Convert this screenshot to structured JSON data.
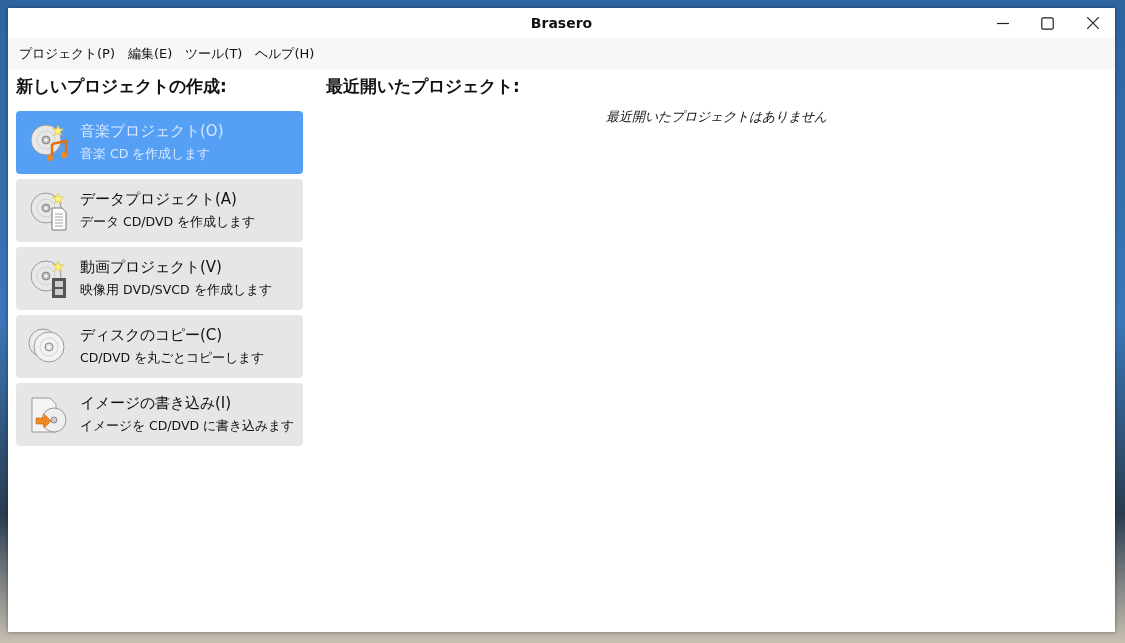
{
  "window": {
    "title": "Brasero"
  },
  "menu": [
    "プロジェクト(P)",
    "編集(E)",
    "ツール(T)",
    "ヘルプ(H)"
  ],
  "new_project": {
    "heading": "新しいプロジェクトの作成:",
    "items": [
      {
        "kind": "audio",
        "title": "音楽プロジェクト(O)",
        "subtitle": "音楽 CD を作成します",
        "selected": true
      },
      {
        "kind": "data",
        "title": "データプロジェクト(A)",
        "subtitle": "データ CD/DVD を作成します",
        "selected": false
      },
      {
        "kind": "video",
        "title": "動画プロジェクト(V)",
        "subtitle": "映像用 DVD/SVCD を作成します",
        "selected": false
      },
      {
        "kind": "copy",
        "title": "ディスクのコピー(C)",
        "subtitle": "CD/DVD を丸ごとコピーします",
        "selected": false
      },
      {
        "kind": "image",
        "title": "イメージの書き込み(I)",
        "subtitle": "イメージを CD/DVD に書き込みます",
        "selected": false
      }
    ]
  },
  "recent": {
    "heading": "最近開いたプロジェクト:",
    "empty_message": "最近開いたプロジェクトはありません"
  }
}
